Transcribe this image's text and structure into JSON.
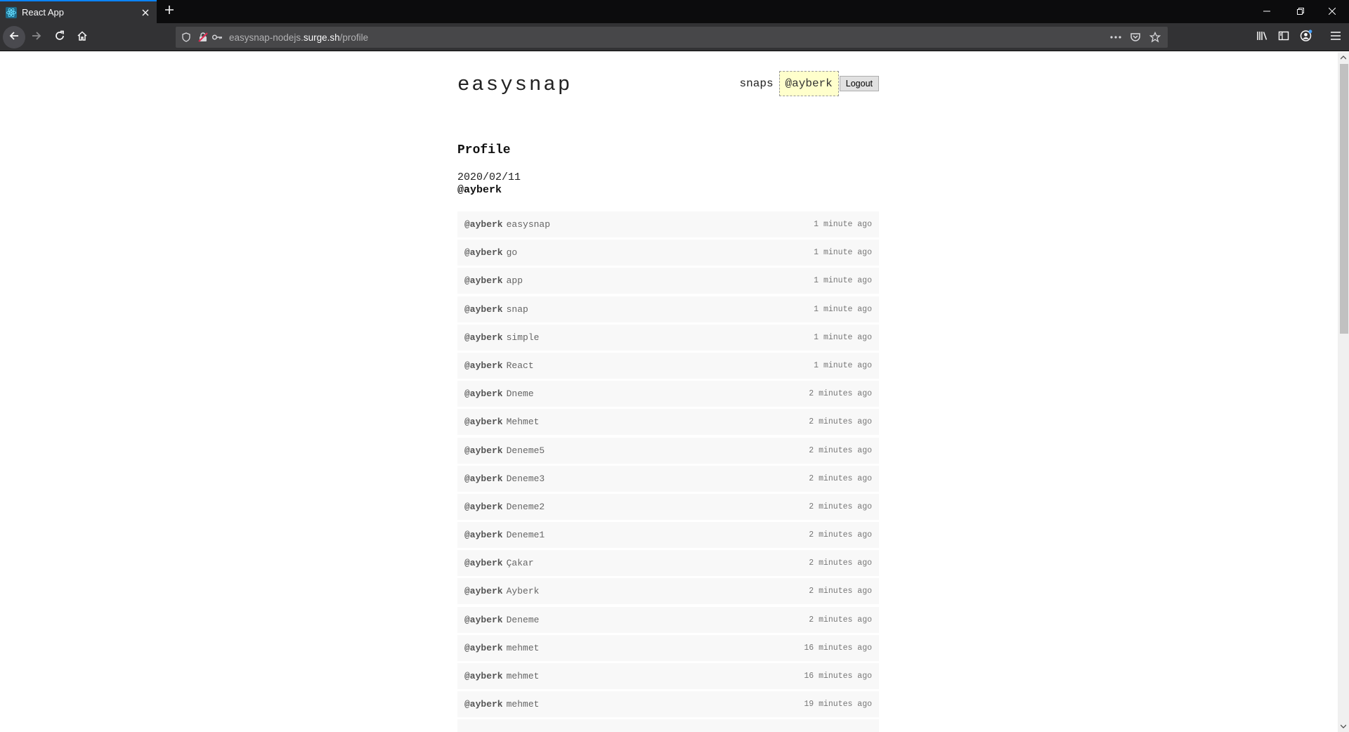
{
  "browser": {
    "tab_title": "React App",
    "url_prefix": "easysnap-nodejs.",
    "url_domain": "surge.sh",
    "url_path": "/profile"
  },
  "header": {
    "logo": "easysnap",
    "nav_snaps": "snaps",
    "nav_user": "@ayberk",
    "logout_label": "Logout"
  },
  "profile": {
    "title": "Profile",
    "date": "2020/02/11",
    "username": "@ayberk"
  },
  "snaps": [
    {
      "user": "@ayberk",
      "text": "easysnap",
      "time": "1 minute ago"
    },
    {
      "user": "@ayberk",
      "text": "go",
      "time": "1 minute ago"
    },
    {
      "user": "@ayberk",
      "text": "app",
      "time": "1 minute ago"
    },
    {
      "user": "@ayberk",
      "text": "snap",
      "time": "1 minute ago"
    },
    {
      "user": "@ayberk",
      "text": "simple",
      "time": "1 minute ago"
    },
    {
      "user": "@ayberk",
      "text": "React",
      "time": "1 minute ago"
    },
    {
      "user": "@ayberk",
      "text": "Dneme",
      "time": "2 minutes ago"
    },
    {
      "user": "@ayberk",
      "text": "Mehmet",
      "time": "2 minutes ago"
    },
    {
      "user": "@ayberk",
      "text": "Deneme5",
      "time": "2 minutes ago"
    },
    {
      "user": "@ayberk",
      "text": "Deneme3",
      "time": "2 minutes ago"
    },
    {
      "user": "@ayberk",
      "text": "Deneme2",
      "time": "2 minutes ago"
    },
    {
      "user": "@ayberk",
      "text": "Deneme1",
      "time": "2 minutes ago"
    },
    {
      "user": "@ayberk",
      "text": "Çakar",
      "time": "2 minutes ago"
    },
    {
      "user": "@ayberk",
      "text": "Ayberk",
      "time": "2 minutes ago"
    },
    {
      "user": "@ayberk",
      "text": "Deneme",
      "time": "2 minutes ago"
    },
    {
      "user": "@ayberk",
      "text": "mehmet",
      "time": "16 minutes ago"
    },
    {
      "user": "@ayberk",
      "text": "mehmet",
      "time": "16 minutes ago"
    },
    {
      "user": "@ayberk",
      "text": "mehmet",
      "time": "19 minutes ago"
    },
    {
      "user": "",
      "text": "",
      "time": ""
    }
  ],
  "colors": {
    "accent": "#0a84ff",
    "user_badge_bg": "#ffffcc",
    "row_bg": "#f8f8f8"
  }
}
